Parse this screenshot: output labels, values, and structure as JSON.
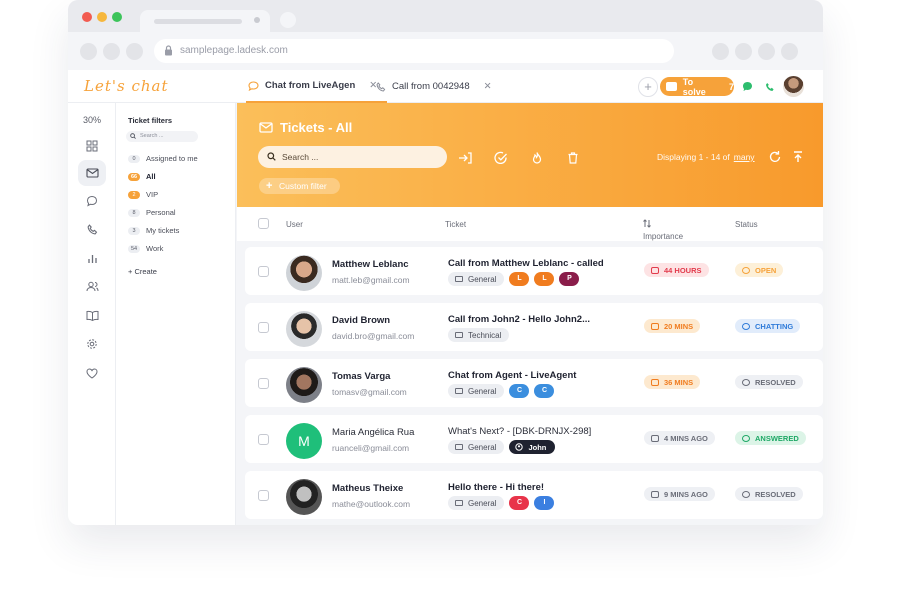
{
  "browser": {
    "url": "samplepage.ladesk.com"
  },
  "app": {
    "logo": "Let's chat",
    "tabs": [
      {
        "label": "Chat from LiveAgen",
        "icon": "chat-icon"
      },
      {
        "label": "Call from 0042948",
        "icon": "phone-icon"
      }
    ],
    "to_solve_label": "To solve",
    "to_solve_count": "7",
    "colors": {
      "accent": "#f6a23a",
      "hero_start": "#fbbf5a",
      "hero_end": "#f89a2c"
    }
  },
  "rail": {
    "percent": "30%",
    "icons": [
      "dashboard-icon",
      "mail-icon",
      "chat-icon",
      "phone-icon",
      "reports-icon",
      "contacts-icon",
      "knowledgebase-icon",
      "settings-icon",
      "heart-icon"
    ]
  },
  "filters": {
    "title": "Ticket filters",
    "search_placeholder": "Search ...",
    "items": [
      {
        "count": "0",
        "label": "Assigned to me"
      },
      {
        "count": "66",
        "label": "All"
      },
      {
        "count": "2",
        "label": "VIP"
      },
      {
        "count": "8",
        "label": "Personal"
      },
      {
        "count": "3",
        "label": "My tickets"
      },
      {
        "count": "54",
        "label": "Work"
      }
    ],
    "create_label": "+ Create"
  },
  "main": {
    "title": "Tickets - All",
    "search_placeholder": "Search ...",
    "display_prefix": "Displaying 1 - 14 of",
    "display_total": "many",
    "custom_filter": "Custom filter",
    "columns": {
      "user": "User",
      "ticket": "Ticket",
      "importance": "Importance",
      "status": "Status"
    }
  },
  "tickets": [
    {
      "name": "Matthew Leblanc",
      "email": "matt.leb@gmail.com",
      "subject": "Call from Matthew Leblanc - called",
      "tag": "General",
      "extra": "pills",
      "pills": [
        {
          "letter": "L",
          "color": "#f07c1f"
        },
        {
          "letter": "L",
          "color": "#f07c1f"
        },
        {
          "letter": "P",
          "color": "#8a1d4a"
        }
      ],
      "importance": "44 HOURS",
      "importance_kind": "red",
      "status": "OPEN",
      "status_kind": "open"
    },
    {
      "name": "David Brown",
      "email": "david.bro@gmail.com",
      "subject": "Call from John2 - Hello John2...",
      "tag": "Technical",
      "extra": "none",
      "pills": [],
      "importance": "20 MINS",
      "importance_kind": "orange",
      "status": "CHATTING",
      "status_kind": "chatting"
    },
    {
      "name": "Tomas Varga",
      "email": "tomasv@gmail.com",
      "subject": "Chat from Agent - LiveAgent",
      "tag": "General",
      "extra": "pills",
      "pills": [
        {
          "letter": "C",
          "color": "#3b8ede"
        },
        {
          "letter": "C",
          "color": "#3b8ede"
        }
      ],
      "importance": "36 MINS",
      "importance_kind": "orange",
      "status": "RESOLVED",
      "status_kind": "resolved"
    },
    {
      "name": "Maria Angélica Rua",
      "initial": "M",
      "email": "ruanceli@gmail.com",
      "subject": "What's Next? - [DBK-DRNJX-298]",
      "tag": "General",
      "extra": "agent",
      "agent": "John",
      "importance": "4 MINS AGO",
      "importance_kind": "gray",
      "status": "ANSWERED",
      "status_kind": "answered"
    },
    {
      "name": "Matheus Theixe",
      "email": "mathe@outlook.com",
      "subject": "Hello there - Hi there!",
      "tag": "General",
      "extra": "pills",
      "pills": [
        {
          "letter": "C",
          "color": "#e8344a"
        },
        {
          "letter": "I",
          "color": "#3b7fe0"
        }
      ],
      "importance": "9 MINS AGO",
      "importance_kind": "gray",
      "status": "RESOLVED",
      "status_kind": "resolved"
    }
  ]
}
